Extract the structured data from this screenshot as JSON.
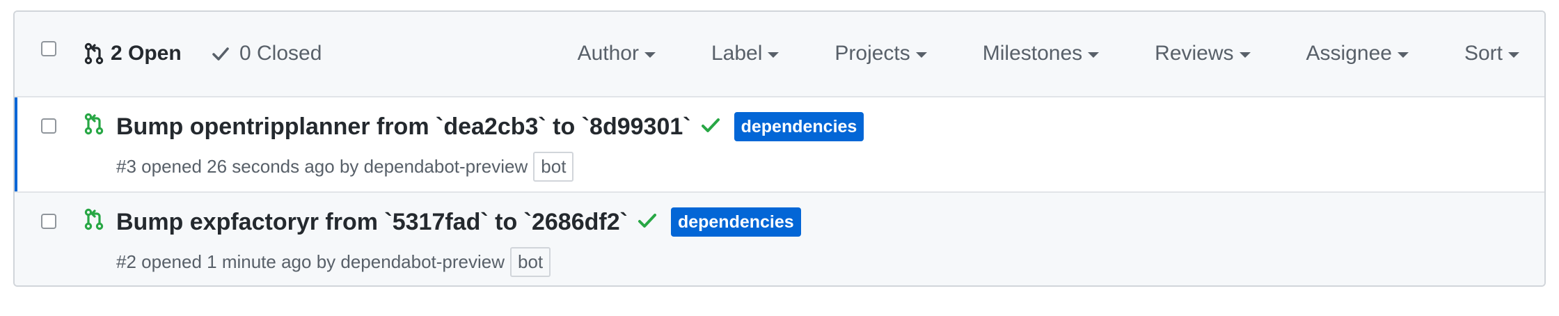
{
  "header": {
    "open_count": "2 Open",
    "closed_count": "0 Closed",
    "filters": [
      "Author",
      "Label",
      "Projects",
      "Milestones",
      "Reviews",
      "Assignee",
      "Sort"
    ]
  },
  "pull_requests": [
    {
      "title": "Bump opentripplanner from `dea2cb3` to `8d99301`",
      "status": "success-check-icon",
      "label": "dependencies",
      "number": "#3",
      "opened_text": "opened 26 seconds ago by",
      "author": "dependabot-preview",
      "badge": "bot"
    },
    {
      "title": "Bump expfactoryr from `5317fad` to `2686df2`",
      "status": "success-check-icon",
      "label": "dependencies",
      "number": "#2",
      "opened_text": "opened 1 minute ago by",
      "author": "dependabot-preview",
      "badge": "bot"
    }
  ],
  "colors": {
    "open_icon": "#28a745",
    "check": "#28a745",
    "label_bg": "#0366d6",
    "selected_accent": "#0366d6"
  }
}
